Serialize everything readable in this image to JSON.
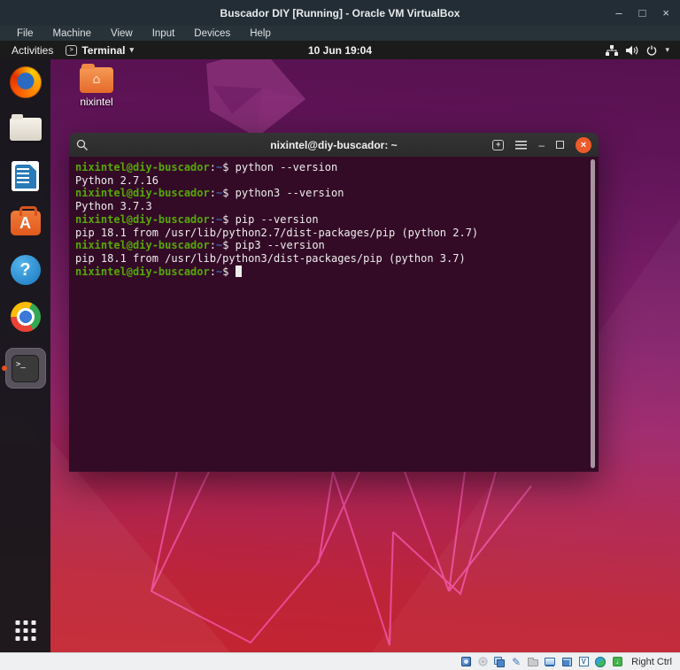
{
  "vbox": {
    "title": "Buscador DIY [Running] - Oracle VM VirtualBox",
    "menu": [
      "File",
      "Machine",
      "View",
      "Input",
      "Devices",
      "Help"
    ],
    "controls": {
      "minimize": "–",
      "maximize": "□",
      "close": "×"
    },
    "status_icons": [
      "hard-disks",
      "optical-drives",
      "network",
      "usb",
      "shared-folders",
      "display",
      "recording",
      "features",
      "mouse-integration",
      "keyboard"
    ],
    "host_key_label": "Right Ctrl"
  },
  "topbar": {
    "activities": "Activities",
    "app_name": "Terminal",
    "clock": "10 Jun 19:04",
    "tray_icons": [
      "wired-network",
      "volume",
      "power",
      "caret-down"
    ]
  },
  "desktop": {
    "home_folder_label": "nixintel"
  },
  "dock": {
    "items": [
      "firefox",
      "files",
      "libreoffice-writer",
      "ubuntu-software",
      "help",
      "chrome",
      "terminal"
    ],
    "show_apps": "show-applications"
  },
  "terminal": {
    "title": "nixintel@diy-buscador: ~",
    "prompt": {
      "user_host": "nixintel@diy-buscador",
      "colon": ":",
      "path": "~",
      "dollar": "$ "
    },
    "lines": [
      {
        "type": "command",
        "command": "python --version"
      },
      {
        "type": "output",
        "text": "Python 2.7.16"
      },
      {
        "type": "command",
        "command": "python3 --version"
      },
      {
        "type": "output",
        "text": "Python 3.7.3"
      },
      {
        "type": "command",
        "command": "pip --version"
      },
      {
        "type": "output",
        "text": "pip 18.1 from /usr/lib/python2.7/dist-packages/pip (python 2.7)"
      },
      {
        "type": "command",
        "command": "pip3 --version"
      },
      {
        "type": "output",
        "text": "pip 18.1 from /usr/lib/python3/dist-packages/pip (python 3.7)"
      },
      {
        "type": "command",
        "command": ""
      }
    ]
  },
  "icons": {
    "caret_down": "▾",
    "terminal_prompt": ">_",
    "mini_terminal_prompt": ">",
    "new_tab_plus": "+",
    "minimize": "–",
    "close": "×",
    "home": "⌂",
    "software_letter": "A",
    "help_mark": "?",
    "usb_glyph": "✎",
    "features_glyph": "V",
    "keyboard_glyph": "↓"
  },
  "colors": {
    "accent_orange": "#e8501f",
    "prompt_green": "#57a807",
    "prompt_blue": "#3465a4",
    "terminal_bg": "#330b27",
    "titlebar_bg": "#222d35",
    "wallpaper_top": "#571150",
    "wallpaper_bottom": "#c42430"
  }
}
